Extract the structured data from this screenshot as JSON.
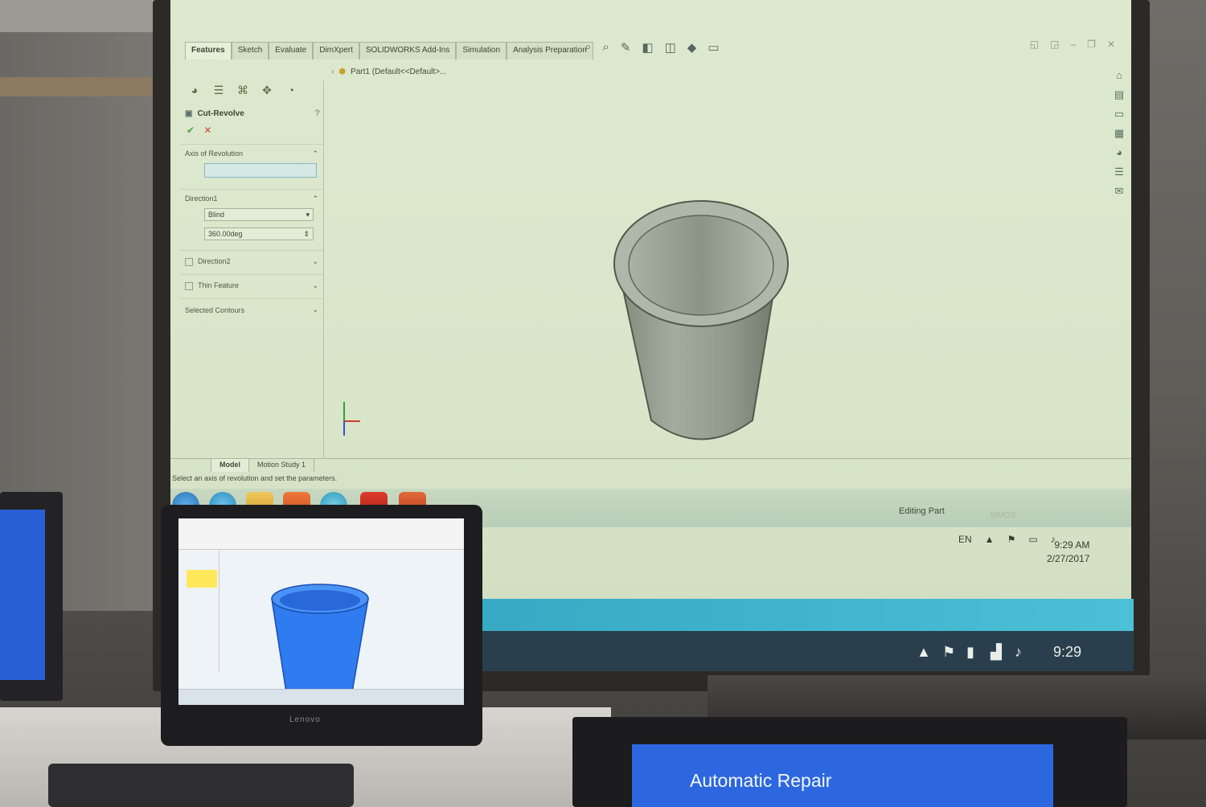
{
  "solidworks": {
    "tabs": [
      "Features",
      "Sketch",
      "Evaluate",
      "DimXpert",
      "SOLIDWORKS Add-Ins",
      "Simulation",
      "Analysis Preparation"
    ],
    "tree_item": "Part1 (Default<<Default>...",
    "property_manager": {
      "title": "Cut-Revolve",
      "axis_group": "Axis of Revolution",
      "direction1_group": "Direction1",
      "end_condition": "Blind",
      "angle": "360.00deg",
      "direction2": "Direction2",
      "thin_feature": "Thin Feature",
      "selected_contours": "Selected Contours"
    },
    "bottom_tabs": [
      "Model",
      "Motion Study 1"
    ],
    "status_message": "Select an axis of revolution and set the parameters.",
    "status_mode": "Editing Part",
    "units": "MMGS",
    "language": "EN",
    "time": "9:29 AM",
    "date": "2/27/2017"
  },
  "lower_taskbar_time": "9:29",
  "monitor_brand": "Lenovo",
  "bottom_monitor_text": "Automatic Repair",
  "colors": {
    "projection_bg": "#dbe8cc",
    "cup_gray": "#8f9a8c",
    "desk_cup_blue": "#2f7cf0",
    "repair_blue": "#2d67e0"
  }
}
